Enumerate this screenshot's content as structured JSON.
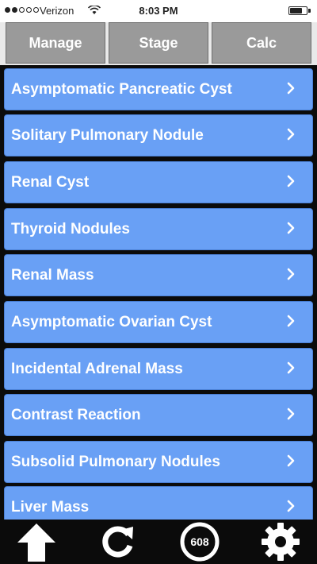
{
  "status_bar": {
    "carrier": "Verizon",
    "time": "8:03 PM",
    "signal_bars_filled": 2,
    "signal_bars_total": 5,
    "battery_level": 0.8
  },
  "tabs": [
    {
      "label": "Manage",
      "active": true
    },
    {
      "label": "Stage",
      "active": false
    },
    {
      "label": "Calc",
      "active": false
    }
  ],
  "list": {
    "chevron_icon": "chevron-right-icon",
    "items": [
      {
        "label": "Asymptomatic Pancreatic Cyst"
      },
      {
        "label": "Solitary Pulmonary Nodule"
      },
      {
        "label": "Renal Cyst"
      },
      {
        "label": "Thyroid Nodules"
      },
      {
        "label": "Renal Mass"
      },
      {
        "label": "Asymptomatic Ovarian Cyst"
      },
      {
        "label": "Incidental Adrenal Mass"
      },
      {
        "label": "Contrast Reaction"
      },
      {
        "label": "Subsolid Pulmonary Nodules"
      },
      {
        "label": "Liver Mass"
      }
    ]
  },
  "toolbar": {
    "home_icon": "home-arrow-icon",
    "refresh_icon": "refresh-icon",
    "count_badge": "608",
    "settings_icon": "gear-icon"
  },
  "colors": {
    "list_item_bg": "#69a0f5",
    "tab_active_bg": "#4d4d4d",
    "tab_inactive_bg": "#9a9a9a",
    "background": "#0b0b0b"
  }
}
